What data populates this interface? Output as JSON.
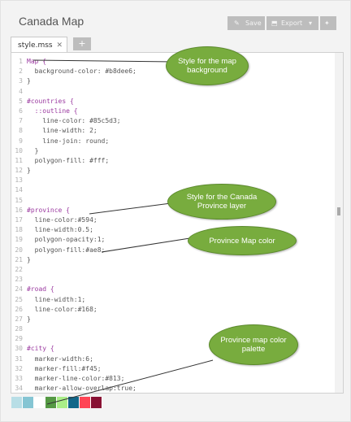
{
  "header": {
    "title": "Canada Map"
  },
  "toolbar": {
    "save_label": "Save",
    "export_label": "Export",
    "export_caret": "▾",
    "wrench": "🔧"
  },
  "tabs": [
    {
      "label": "style.mss",
      "close": "✕"
    }
  ],
  "add_tab_label": "+",
  "code": [
    {
      "n": "1",
      "t": "Map {",
      "type": "sel"
    },
    {
      "n": "2",
      "t": "  background-color: #b8dee6;",
      "type": "prop"
    },
    {
      "n": "3",
      "t": "}",
      "type": "prop"
    },
    {
      "n": "4",
      "t": "",
      "type": "prop"
    },
    {
      "n": "5",
      "t": "#countries {",
      "type": "sel"
    },
    {
      "n": "6",
      "t": "  ::outline {",
      "type": "sel"
    },
    {
      "n": "7",
      "t": "    line-color: #85c5d3;",
      "type": "prop"
    },
    {
      "n": "8",
      "t": "    line-width: 2;",
      "type": "prop"
    },
    {
      "n": "9",
      "t": "    line-join: round;",
      "type": "prop"
    },
    {
      "n": "10",
      "t": "  }",
      "type": "prop"
    },
    {
      "n": "11",
      "t": "  polygon-fill: #fff;",
      "type": "prop"
    },
    {
      "n": "12",
      "t": "}",
      "type": "prop"
    },
    {
      "n": "13",
      "t": "",
      "type": "prop"
    },
    {
      "n": "14",
      "t": "",
      "type": "prop"
    },
    {
      "n": "15",
      "t": "",
      "type": "prop"
    },
    {
      "n": "16",
      "t": "#province {",
      "type": "sel"
    },
    {
      "n": "17",
      "t": "  line-color:#594;",
      "type": "prop"
    },
    {
      "n": "18",
      "t": "  line-width:0.5;",
      "type": "prop"
    },
    {
      "n": "19",
      "t": "  polygon-opacity:1;",
      "type": "prop"
    },
    {
      "n": "20",
      "t": "  polygon-fill:#ae8;",
      "type": "prop"
    },
    {
      "n": "21",
      "t": "}",
      "type": "prop"
    },
    {
      "n": "22",
      "t": "",
      "type": "prop"
    },
    {
      "n": "23",
      "t": "",
      "type": "prop"
    },
    {
      "n": "24",
      "t": "#road {",
      "type": "sel"
    },
    {
      "n": "25",
      "t": "  line-width:1;",
      "type": "prop"
    },
    {
      "n": "26",
      "t": "  line-color:#168;",
      "type": "prop"
    },
    {
      "n": "27",
      "t": "}",
      "type": "prop"
    },
    {
      "n": "28",
      "t": "",
      "type": "prop"
    },
    {
      "n": "29",
      "t": "",
      "type": "prop"
    },
    {
      "n": "30",
      "t": "#city {",
      "type": "sel"
    },
    {
      "n": "31",
      "t": "  marker-width:6;",
      "type": "prop"
    },
    {
      "n": "32",
      "t": "  marker-fill:#f45;",
      "type": "prop"
    },
    {
      "n": "33",
      "t": "  marker-line-color:#813;",
      "type": "prop"
    },
    {
      "n": "34",
      "t": "  marker-allow-overlap:true;",
      "type": "prop"
    }
  ],
  "palette": [
    "#b8dee6",
    "#85c5d3",
    "#ffffff",
    "#559944",
    "#aaee88",
    "#116688",
    "#ff4455",
    "#881133"
  ],
  "callouts": [
    {
      "text": "Style for the map background"
    },
    {
      "text": "Style for the Canada Province layer"
    },
    {
      "text": "Province Map color"
    },
    {
      "text": "Province map color palette"
    }
  ],
  "colors": {
    "accent": "#78ac3e",
    "selector": "#9b3aa0",
    "value": "#2a6cc6"
  }
}
